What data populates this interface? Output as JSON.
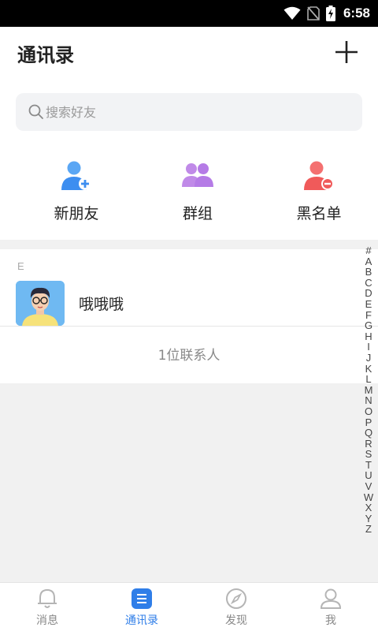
{
  "status_bar": {
    "time": "6:58"
  },
  "header": {
    "title": "通讯录"
  },
  "search": {
    "placeholder": "搜索好友"
  },
  "quick_actions": [
    {
      "label": "新朋友",
      "icon": "add-user-icon",
      "color": "#3d8ef0"
    },
    {
      "label": "群组",
      "icon": "group-icon",
      "color": "#b57be6"
    },
    {
      "label": "黑名单",
      "icon": "block-user-icon",
      "color": "#f05a5a"
    }
  ],
  "contacts": {
    "section_letter": "E",
    "items": [
      {
        "name": "哦哦哦"
      }
    ],
    "count_text": "1位联系人"
  },
  "alpha_index": [
    "#",
    "A",
    "B",
    "C",
    "D",
    "E",
    "F",
    "G",
    "H",
    "I",
    "J",
    "K",
    "L",
    "M",
    "N",
    "O",
    "P",
    "Q",
    "R",
    "S",
    "T",
    "U",
    "V",
    "W",
    "X",
    "Y",
    "Z"
  ],
  "tabs": [
    {
      "label": "消息",
      "icon": "bell-icon",
      "active": false
    },
    {
      "label": "通讯录",
      "icon": "contacts-icon",
      "active": true
    },
    {
      "label": "发现",
      "icon": "compass-icon",
      "active": false
    },
    {
      "label": "我",
      "icon": "profile-icon",
      "active": false
    }
  ],
  "colors": {
    "accent": "#2f7ee8",
    "background": "#f1f1f1"
  }
}
